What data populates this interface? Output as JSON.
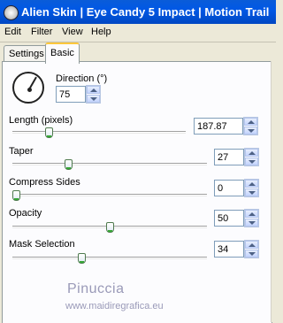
{
  "window": {
    "title": "Alien Skin | Eye Candy 5 Impact | Motion Trail"
  },
  "menu": {
    "items": [
      "Edit",
      "Filter",
      "View",
      "Help"
    ]
  },
  "tabs": [
    {
      "label": "Settings",
      "active": false
    },
    {
      "label": "Basic",
      "active": true
    }
  ],
  "controls": {
    "direction": {
      "label": "Direction (°)",
      "value": "75",
      "dial_angle_deg": 75
    },
    "length": {
      "label": "Length (pixels)",
      "value": "187.87",
      "slider_fraction": 0.22
    },
    "taper": {
      "label": "Taper",
      "value": "27",
      "slider_fraction": 0.27
    },
    "compress_sides": {
      "label": "Compress Sides",
      "value": "0",
      "slider_fraction": 0.0
    },
    "opacity": {
      "label": "Opacity",
      "value": "50",
      "slider_fraction": 0.5
    },
    "mask_selection": {
      "label": "Mask Selection",
      "value": "34",
      "slider_fraction": 0.34
    }
  },
  "watermark": {
    "name": "Pinuccia",
    "url": "www.maidiregrafica.eu"
  },
  "colors": {
    "titlebar": "#0058e6",
    "tab_highlight": "#ffc83c",
    "panel": "#fcfcfe",
    "slider_thumb_accent": "#35a635"
  }
}
